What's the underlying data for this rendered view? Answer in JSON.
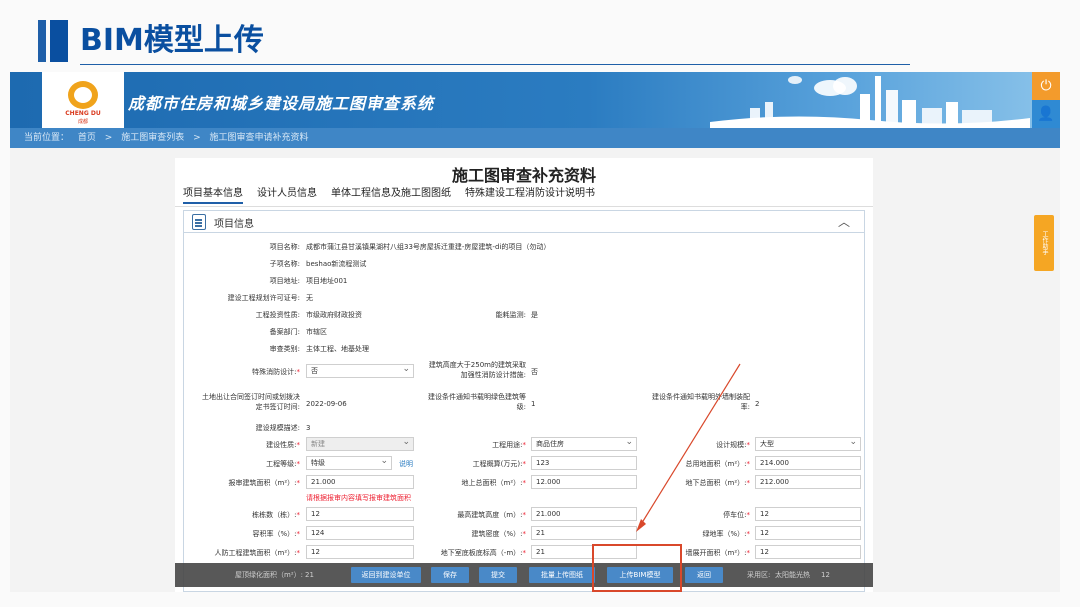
{
  "slide": {
    "title": "BIM模型上传"
  },
  "header": {
    "logo_text": "CHENG DU",
    "logo_sub": "成都",
    "system_title": "成都市住房和城乡建设局施工图审查系统"
  },
  "breadcrumb": {
    "prefix": "当前位置：",
    "items": [
      "首页",
      ">",
      "施工图审查列表",
      ">",
      "施工图审查申请补充资料"
    ]
  },
  "panel": {
    "title": "施工图审查补充资料",
    "tabs": [
      "项目基本信息",
      "设计人员信息",
      "单体工程信息及施工图图纸",
      "特殊建设工程消防设计说明书"
    ],
    "section_title": "项目信息"
  },
  "fields": {
    "project_name_label": "项目名称:",
    "project_name": "成都市蒲江县甘溪镇果湖村八组33号房屋拆迁重建-房屋建筑-di的项目（勿动）",
    "sub_name_label": "子项名称:",
    "sub_name": "beshao新流程测试",
    "address_label": "项目地址:",
    "address": "项目地址001",
    "permit_label": "建设工程规划许可证号:",
    "permit": "无",
    "invest_label": "工程投资性质:",
    "invest": "市级政府财政投资",
    "energy_label": "能耗监测:",
    "energy": "是",
    "record_dept_label": "备案部门:",
    "record_dept": "市辖区",
    "review_type_label": "审查类别:",
    "review_type": "主体工程、地基处理",
    "fire_label": "特殊消防设计:",
    "fire": "否",
    "height_label": "建筑高度大于250m的建筑采取加强性消防设计措施:",
    "height": "否",
    "land_date_label": "土地出让合同签订时间或划拨决定书签订时间:",
    "land_date": "2022-09-06",
    "green_a_label": "建设条件通知书载明绿色建筑等级:",
    "green_a": "1",
    "green_b_label": "建设条件通知书载明外墙制装配率:",
    "green_b": "2",
    "scale_label": "建设规模描述:",
    "scale": "3",
    "nature_label": "建设性质:",
    "nature": "新建",
    "use_label": "工程用途:",
    "use": "商品住房",
    "design_scale_label": "设计规模:",
    "design_scale": "大型",
    "grade_label": "工程等级:",
    "grade": "特级",
    "grade_link": "说明",
    "invest_amt_label": "工程概算(万元):",
    "invest_amt": "123",
    "land_area_label": "总用地面积（m²）:",
    "land_area": "214.000",
    "report_area_label": "报审建筑面积（m²）:",
    "report_area": "21.000",
    "above_area_label": "地上总面积（m²）:",
    "above_area": "12.000",
    "under_area_label": "地下总面积（m²）:",
    "under_area": "212.000",
    "warn": "请根据报审内容填写报审建筑面积",
    "buildings_label": "栋栋数（栋）:",
    "buildings": "12",
    "max_height_label": "最高建筑高度（m）:",
    "max_height": "21.000",
    "parking_label": "停车位:",
    "parking": "12",
    "far_label": "容积率（%）:",
    "far": "124",
    "density_label": "建筑密度（%）:",
    "density": "21",
    "green_rate_label": "绿地率（%）:",
    "green_rate": "12",
    "civil_label": "人防工程建筑面积（m²）:",
    "civil": "12",
    "base_elev_label": "地下室底板底标高（-m）:",
    "base_elev": "21",
    "facade_label": "墙展开面积（m²）:",
    "facade": "12",
    "row8_label": "屋顶绿化面积（m²）:",
    "row8": "21",
    "row8b_label": "采用区:",
    "row8b": "太阳能光热",
    "row8c": "12"
  },
  "toolbar": {
    "back": "返回到建设单位",
    "save": "保存",
    "submit": "提交",
    "batch": "批量上传图纸",
    "upload_bim": "上传BIM模型",
    "return": "返回"
  },
  "float_tab": "工作助手",
  "colors": {
    "accent": "#1f5fa8",
    "banner": "#2b7cc1",
    "highlight": "#d9482b",
    "toolbar_btn": "#3a7fc4"
  }
}
